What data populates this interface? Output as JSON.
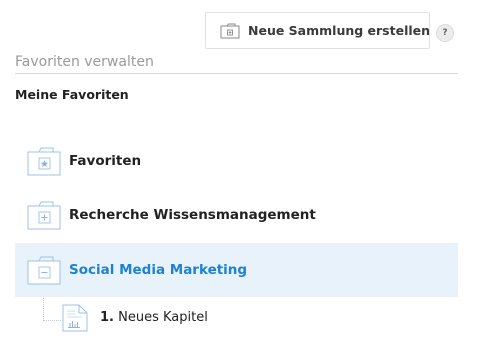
{
  "toolbar": {
    "new_collection_label": "Neue Sammlung erstellen",
    "help_label": "?"
  },
  "header": {
    "title": "Favoriten verwalten",
    "subtitle": "Meine Favoriten"
  },
  "collections": [
    {
      "label": "Favoriten",
      "icon": "star-folder-icon",
      "selected": false
    },
    {
      "label": "Recherche Wissensmanagement",
      "icon": "plus-folder-icon",
      "selected": false
    },
    {
      "label": "Social Media Marketing",
      "icon": "minus-folder-icon",
      "selected": true
    }
  ],
  "chapters": [
    {
      "number": "1.",
      "title": "Neues Kapitel",
      "icon": "document-chart-icon"
    }
  ],
  "colors": {
    "accent": "#1d82d2",
    "selected_bg": "#e8f2fb",
    "icon_stroke": "#9cc3e6"
  }
}
